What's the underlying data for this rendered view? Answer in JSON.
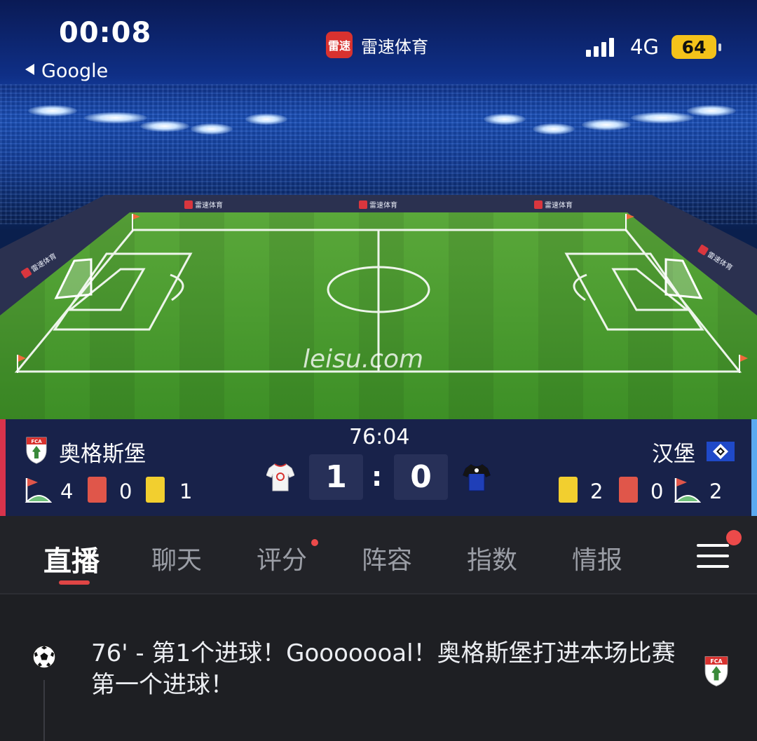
{
  "status_bar": {
    "time": "00:08",
    "back_label": "Google",
    "network": "4G",
    "battery": "64"
  },
  "app": {
    "logo_text": "雷速",
    "name": "雷速体育"
  },
  "stadium": {
    "watermark": "leisu.com",
    "ad_text": "雷速体育"
  },
  "match": {
    "clock": "76:04",
    "separator": ":",
    "home": {
      "name": "奥格斯堡",
      "score": "1",
      "corners": "4",
      "red_cards": "0",
      "yellow_cards": "1",
      "color": "#d8334c"
    },
    "away": {
      "name": "汉堡",
      "score": "0",
      "corners": "2",
      "red_cards": "0",
      "yellow_cards": "2",
      "color": "#5aa9f0"
    }
  },
  "tabs": [
    {
      "label": "直播",
      "active": true
    },
    {
      "label": "聊天"
    },
    {
      "label": "评分",
      "badge": true
    },
    {
      "label": "阵容"
    },
    {
      "label": "指数"
    },
    {
      "label": "情报"
    }
  ],
  "feed": {
    "events": [
      {
        "icon": "soccer-ball-icon",
        "text": "76' - 第1个进球！Gooooooal！奥格斯堡打进本场比赛第一个进球！",
        "team": "home"
      }
    ]
  },
  "colors": {
    "accent_red": "#e04545",
    "yellow_card": "#f2cf2f",
    "red_card": "#e0564a",
    "panel_bg": "#18224a",
    "battery": "#f4c21a"
  }
}
